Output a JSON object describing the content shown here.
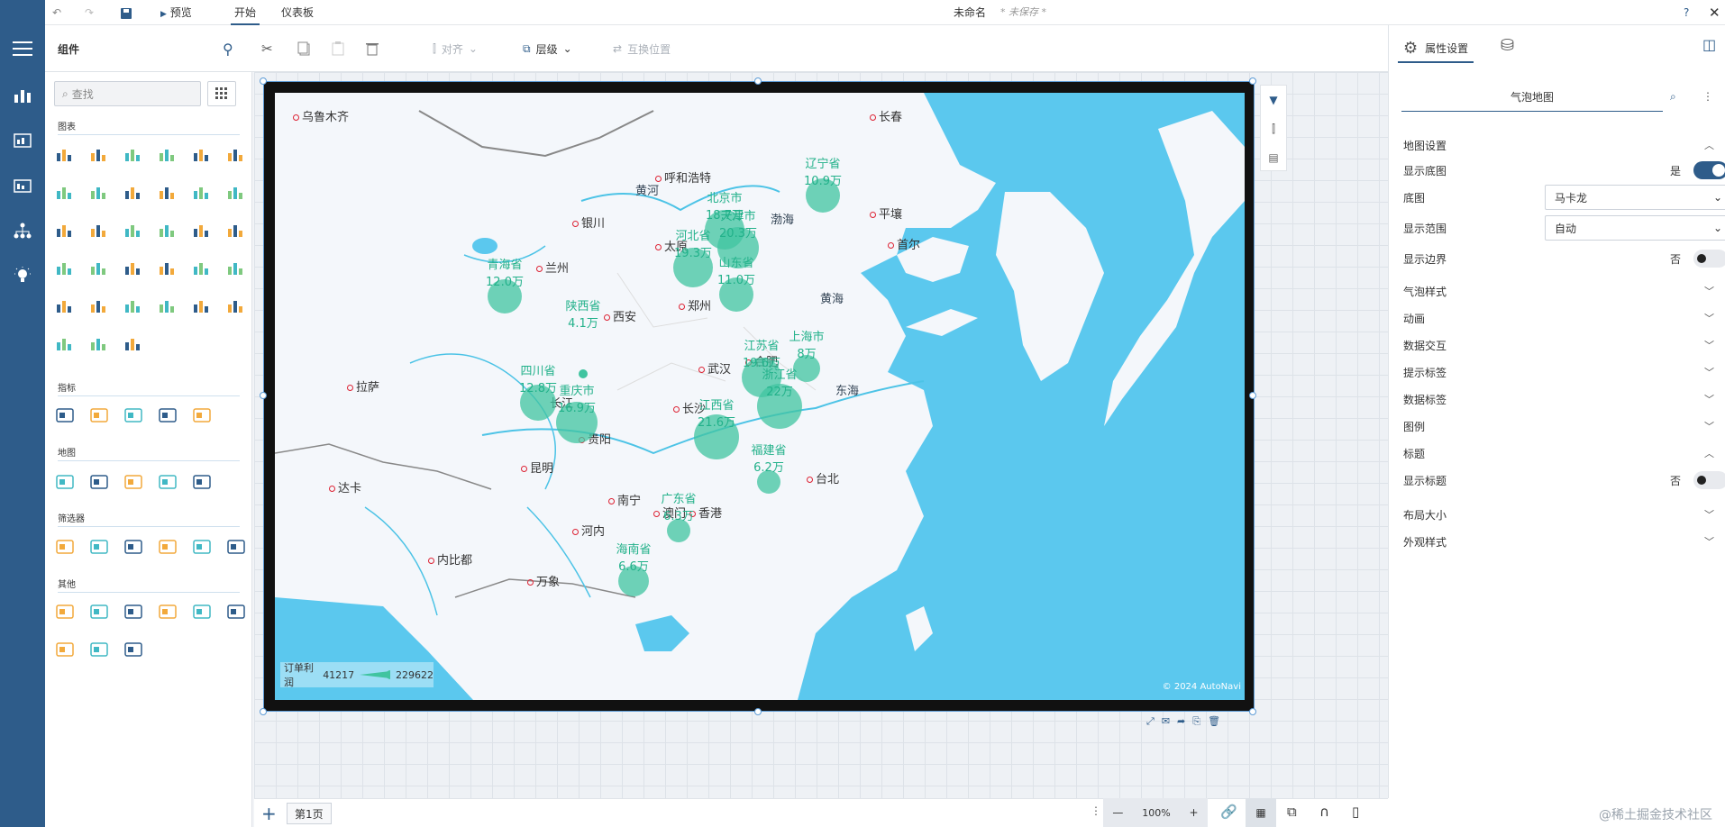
{
  "topbar": {
    "preview_label": "预览",
    "tabs": [
      "开始",
      "仪表板"
    ],
    "doc_title": "未命名",
    "doc_status": "* 未保存 *"
  },
  "toolbar": {
    "components_label": "组件",
    "align_label": "对齐",
    "layer_label": "层级",
    "swap_label": "互换位置"
  },
  "components": {
    "search_placeholder": "查找",
    "categories": [
      "图表",
      "指标",
      "地图",
      "筛选器",
      "其他"
    ]
  },
  "map": {
    "cities": [
      {
        "name": "乌鲁木齐"
      },
      {
        "name": "长春"
      },
      {
        "name": "呼和浩特"
      },
      {
        "name": "银川"
      },
      {
        "name": "兰州"
      },
      {
        "name": "太原"
      },
      {
        "name": "西安"
      },
      {
        "name": "郑州"
      },
      {
        "name": "拉萨"
      },
      {
        "name": "武汉"
      },
      {
        "name": "合肥"
      },
      {
        "name": "长沙"
      },
      {
        "name": "贵阳"
      },
      {
        "name": "昆明"
      },
      {
        "name": "南宁"
      },
      {
        "name": "澳门"
      },
      {
        "name": "香港"
      },
      {
        "name": "台北"
      },
      {
        "name": "平壤"
      },
      {
        "name": "首尔"
      },
      {
        "name": "河内"
      },
      {
        "name": "内比都"
      },
      {
        "name": "达卡"
      },
      {
        "name": "万象"
      },
      {
        "name": "长江"
      }
    ],
    "seas": [
      "渤海",
      "黄海",
      "东海",
      "黄河"
    ],
    "bubbles": [
      {
        "province": "辽宁省",
        "value": "10.9万"
      },
      {
        "province": "北京市",
        "value": "18.7万"
      },
      {
        "province": "天津市",
        "value": "20.3万"
      },
      {
        "province": "河北省",
        "value": "19.3万"
      },
      {
        "province": "山东省",
        "value": "11.0万"
      },
      {
        "province": "青海省",
        "value": "12.0万"
      },
      {
        "province": "陕西省",
        "value": "4.1万"
      },
      {
        "province": "江苏省",
        "value": "19.6万"
      },
      {
        "province": "上海市",
        "value": "8万"
      },
      {
        "province": "浙江省",
        "value": "22万"
      },
      {
        "province": "四川省",
        "value": "12.8万"
      },
      {
        "province": "重庆市",
        "value": "16.9万"
      },
      {
        "province": "江西省",
        "value": "21.6万"
      },
      {
        "province": "福建省",
        "value": "6.2万"
      },
      {
        "province": "广东省",
        "value": "6.3万"
      },
      {
        "province": "海南省",
        "value": "6.6万"
      }
    ],
    "legend": {
      "title": "订单利润",
      "min": "41217",
      "max": "229622"
    },
    "copyright": "© 2024 AutoNavi"
  },
  "properties": {
    "tab_label": "属性设置",
    "chart_name": "气泡地图",
    "sections": [
      {
        "label": "地图设置",
        "expanded": true
      },
      {
        "label": "气泡样式",
        "expanded": false
      },
      {
        "label": "动画",
        "expanded": false
      },
      {
        "label": "数据交互",
        "expanded": false
      },
      {
        "label": "提示标签",
        "expanded": false
      },
      {
        "label": "数据标签",
        "expanded": false
      },
      {
        "label": "图例",
        "expanded": false
      },
      {
        "label": "标题",
        "expanded": true
      },
      {
        "label": "布局大小",
        "expanded": false
      },
      {
        "label": "外观样式",
        "expanded": false
      }
    ],
    "show_basemap": {
      "label": "显示底图",
      "state": "是"
    },
    "basemap": {
      "label": "底图",
      "value": "马卡龙"
    },
    "range": {
      "label": "显示范围",
      "value": "自动"
    },
    "show_border": {
      "label": "显示边界",
      "state": "否"
    },
    "show_title": {
      "label": "显示标题",
      "state": "否"
    }
  },
  "bottom": {
    "page_tab": "第1页",
    "zoom": "100%",
    "watermark": "@稀土掘金技术社区"
  },
  "colors": {
    "nav": "#2e5c8a",
    "accent": "#2e5c8a",
    "bubble": "#40c4a0",
    "sea": "#5bc8ee"
  }
}
